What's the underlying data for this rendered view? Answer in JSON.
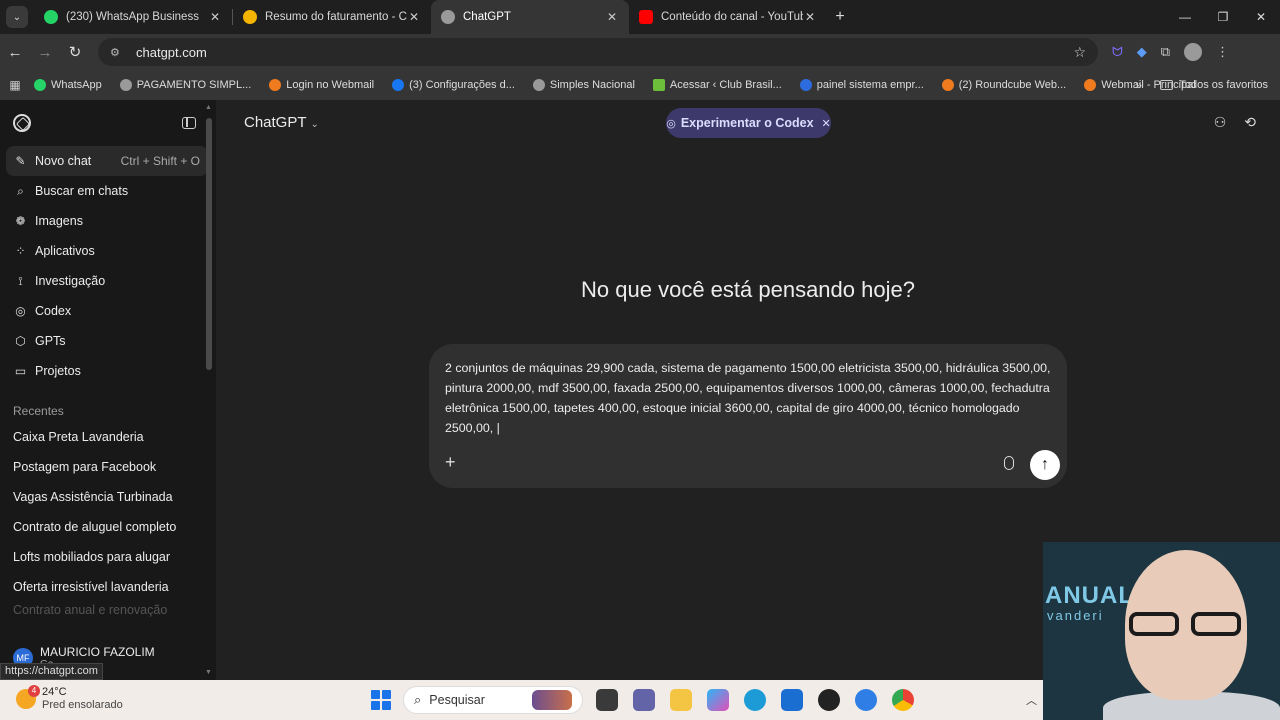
{
  "browser": {
    "tabs": [
      {
        "title": "(230) WhatsApp Business",
        "color": "#25d366",
        "active": false
      },
      {
        "title": "Resumo do faturamento - CAM",
        "color": "#f4b400",
        "active": false
      },
      {
        "title": "ChatGPT",
        "color": "#9a9a9a",
        "active": true
      },
      {
        "title": "Conteúdo do canal - YouTube S",
        "color": "#ff0000",
        "active": false
      }
    ],
    "url": "chatgpt.com",
    "bookmarks": [
      {
        "label": "WhatsApp",
        "color": "#25d366"
      },
      {
        "label": "PAGAMENTO SIMPL...",
        "color": "#9a9a9a"
      },
      {
        "label": "Login no Webmail",
        "color": "#f07b1f"
      },
      {
        "label": "(3) Configurações d...",
        "color": "#1877f2"
      },
      {
        "label": "Simples Nacional",
        "color": "#9a9a9a"
      },
      {
        "label": "Acessar ‹ Club Brasil...",
        "color": "#6dbf3b"
      },
      {
        "label": "painel sistema empr...",
        "color": "#2d6cdf"
      },
      {
        "label": "(2) Roundcube Web...",
        "color": "#f07b1f"
      },
      {
        "label": "Webmail - Principal",
        "color": "#f07b1f"
      }
    ],
    "all_bookmarks": "Todos os favoritos"
  },
  "sidebar": {
    "items": [
      {
        "label": "Novo chat",
        "shortcut": "Ctrl + Shift + O",
        "icon": "edit-icon"
      },
      {
        "label": "Buscar em chats",
        "icon": "search-icon"
      },
      {
        "label": "Imagens",
        "icon": "images-icon"
      },
      {
        "label": "Aplicativos",
        "icon": "apps-icon"
      },
      {
        "label": "Investigação",
        "icon": "telescope-icon"
      },
      {
        "label": "Codex",
        "icon": "codex-icon"
      },
      {
        "label": "GPTs",
        "icon": "cube-icon"
      },
      {
        "label": "Projetos",
        "icon": "folder-icon"
      }
    ],
    "recent_heading": "Recentes",
    "recents": [
      "Caixa Preta Lavanderia",
      "Postagem para Facebook",
      "Vagas Assistência Turbinada",
      "Contrato de aluguel completo",
      "Lofts mobiliados para alugar",
      "Oferta irresistível lavanderia",
      "Contrato anual e renovação"
    ],
    "user": {
      "initials": "MF",
      "name": "MAURICIO FAZOLIM",
      "plan": "Go"
    }
  },
  "status_url": "https://chatgpt.com",
  "main": {
    "model": "ChatGPT",
    "codex_pill": "Experimentar o Codex",
    "heading": "No que você está pensando hoje?",
    "composer_text": "2 conjuntos de máquinas 29,900 cada, sistema de pagamento 1500,00 eletricista 3500,00, hidráulica 3500,00, pintura 2000,00, mdf 3500,00, faxada 2500,00, equipamentos diversos 1000,00, câmeras 1000,00, fechadutra eletrônica 1500,00, tapetes 400,00, estoque inicial 3600,00, capital de giro 4000,00, técnico homologado 2500,00, |"
  },
  "taskbar": {
    "temperature": "24°C",
    "weather": "Pred ensolarado",
    "weather_badge": "4",
    "search_placeholder": "Pesquisar"
  },
  "webcam": {
    "text1": "ANUAL",
    "text2": "vanderi"
  }
}
